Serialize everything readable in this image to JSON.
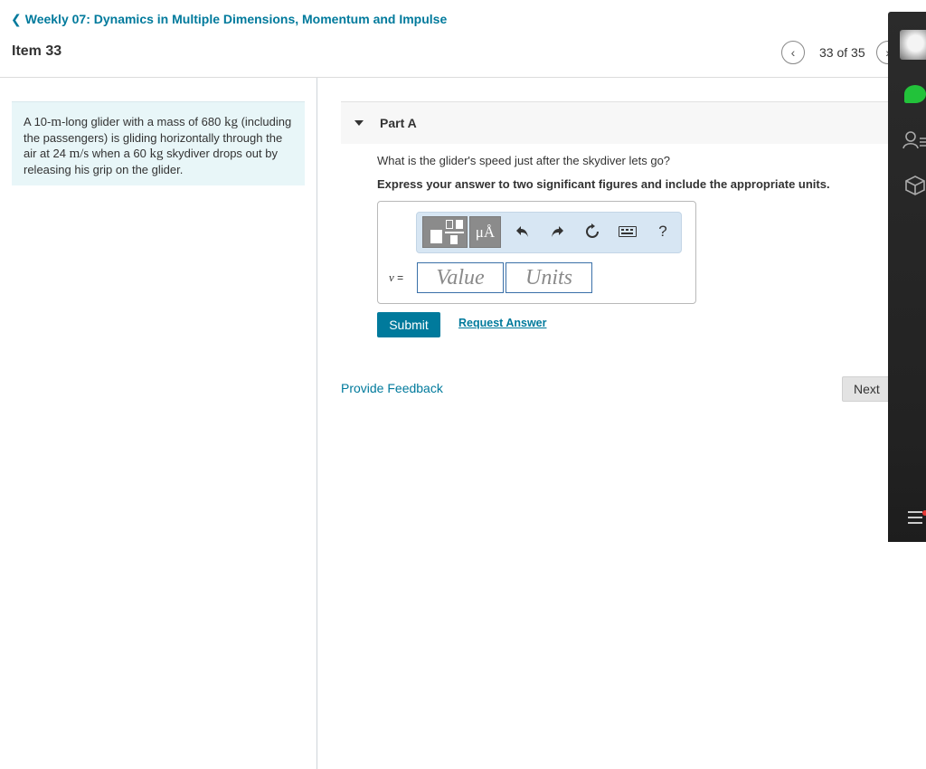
{
  "nav": {
    "back_label": "Weekly 07: Dynamics in Multiple Dimensions, Momentum and Impulse",
    "item_title": "Item 33",
    "pager_text": "33 of 35"
  },
  "problem": {
    "t1": "A 10-",
    "u1": "m",
    "t2": "-long glider with a mass of 680 ",
    "u2": "kg",
    "t3": " (including the passengers) is gliding horizontally through the air at 24 ",
    "u3": "m/s",
    "t4": " when a 60 ",
    "u4": "kg",
    "t5": " skydiver drops out by releasing his grip on the glider."
  },
  "part": {
    "label": "Part A",
    "question": "What is the glider's speed just after the skydiver lets go?",
    "instruction": "Express your answer to two significant figures and include the appropriate units."
  },
  "answer": {
    "units_tool": "μÅ",
    "help": "?",
    "variable": "v",
    "equals": " =",
    "value_placeholder": "Value",
    "units_placeholder": "Units"
  },
  "actions": {
    "submit": "Submit",
    "request": "Request Answer",
    "feedback": "Provide Feedback",
    "next": "Next"
  },
  "colors": {
    "accent": "#007a9c",
    "chat_green": "#22c23a"
  }
}
